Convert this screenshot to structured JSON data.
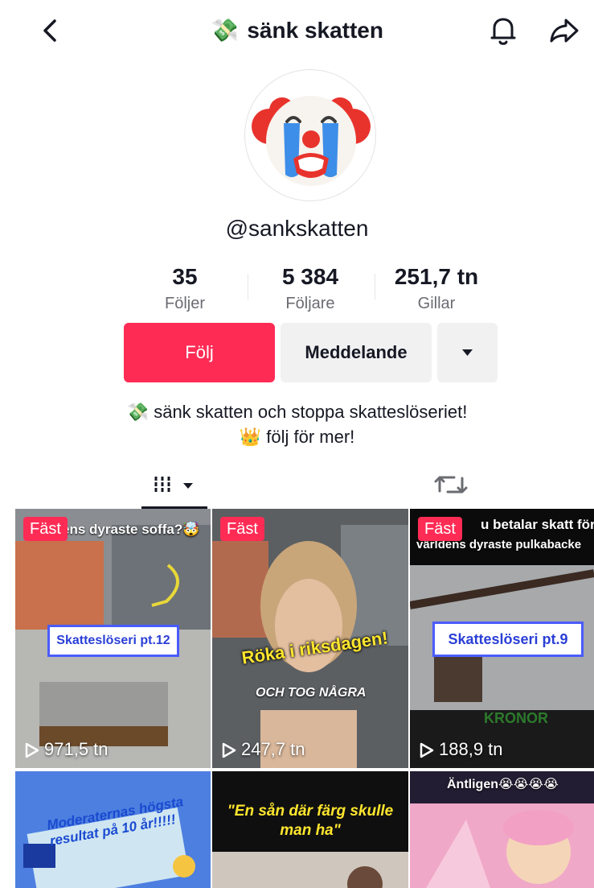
{
  "header": {
    "title": "sänk skatten",
    "title_emoji": "💸"
  },
  "profile": {
    "username": "@sankskatten",
    "avatar_emoji": "clown-face-crying"
  },
  "stats": [
    {
      "value": "35",
      "label": "Följer"
    },
    {
      "value": "5 384",
      "label": "Följare"
    },
    {
      "value": "251,7 tn",
      "label": "Gillar"
    }
  ],
  "actions": {
    "follow_label": "Följ",
    "message_label": "Meddelande"
  },
  "bio": {
    "line1_emoji": "💸",
    "line1": "sänk skatten och stoppa skatteslöseriet!",
    "line2_emoji": "👑",
    "line2": "följ för mer!"
  },
  "videos": [
    {
      "pinned": "Fäst",
      "views": "971,5 tn",
      "caption": "ens dyraste soffa?🤯",
      "badge": "Skatteslöseri pt.12"
    },
    {
      "pinned": "Fäst",
      "views": "247,7 tn",
      "caption": "Röka i riksdagen!",
      "subcaption": "OCH TOG NÅGRA"
    },
    {
      "pinned": "Fäst",
      "views": "188,9 tn",
      "caption": "u betalar skatt för",
      "caption2": "världens dyraste pulkabacke",
      "badge": "Skatteslöseri pt.9",
      "watermark": "KRONOR"
    },
    {
      "caption": "Moderaternas högsta resultat på 10 år!!!!!"
    },
    {
      "caption": "\"En sån där färg skulle man ha\""
    },
    {
      "caption": "Äntligen😭😭😭😭"
    }
  ],
  "colors": {
    "accent": "#fe2c55",
    "secondary_button": "#f1f1f2",
    "text": "#161823",
    "muted": "#6b6c72"
  }
}
